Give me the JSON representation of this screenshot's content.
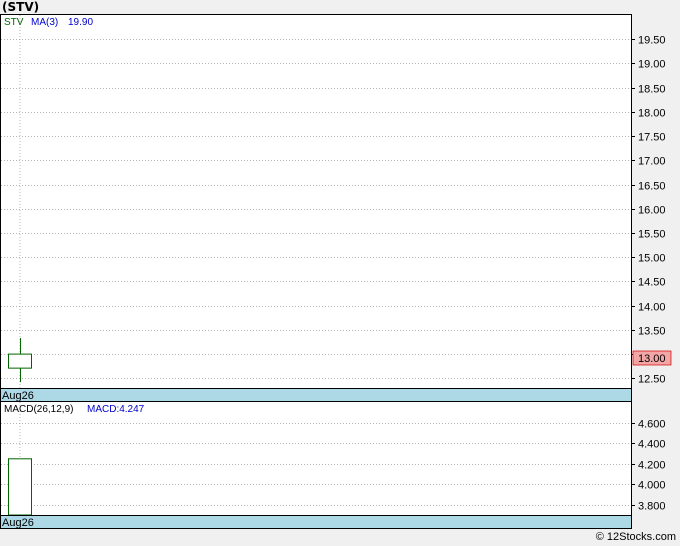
{
  "title": "(STV)",
  "footer": "© 12Stocks.com",
  "price_panel": {
    "symbol": "STV",
    "ma_label": "MA(3)",
    "ma_value": "19.90",
    "date_label": "Aug26",
    "last_price_label": "13.00"
  },
  "macd_panel": {
    "label": "MACD(26,12,9)",
    "value_label": "MACD:4.247",
    "date_label": "Aug26"
  },
  "colors": {
    "candle": "#006400",
    "ma_text": "#0000cc",
    "macd_bar": "#006400",
    "date_band": "#add8e6",
    "price_badge": "#f4a6a6",
    "grid": "#b4b4b4"
  },
  "chart_data": [
    {
      "type": "candlestick",
      "title": "",
      "xlabel": "",
      "ylabel": "",
      "categories": [
        "Aug26"
      ],
      "ylim": [
        12.3,
        20.0
      ],
      "yticks": [
        "12.50",
        "13.00",
        "13.50",
        "14.00",
        "14.50",
        "15.00",
        "15.50",
        "16.00",
        "16.50",
        "17.00",
        "17.50",
        "18.00",
        "18.50",
        "19.00",
        "19.50"
      ],
      "series": [
        {
          "x": "Aug26",
          "open": 12.71,
          "high": 13.33,
          "low": 12.42,
          "close": 13.0
        }
      ],
      "grid": true
    },
    {
      "type": "bar",
      "title": "",
      "xlabel": "",
      "ylabel": "",
      "categories": [
        "Aug26"
      ],
      "values": [
        4.247
      ],
      "ylim": [
        3.7,
        4.8
      ],
      "yticks": [
        "3.800",
        "4.000",
        "4.200",
        "4.400",
        "4.600"
      ],
      "grid": true
    }
  ]
}
